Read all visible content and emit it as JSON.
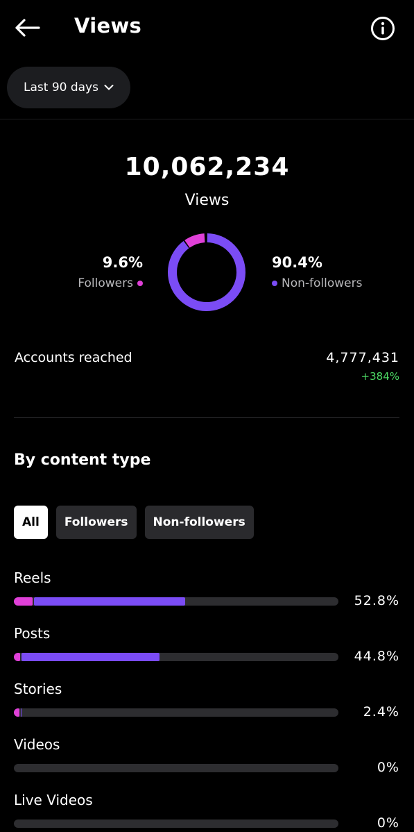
{
  "header": {
    "title": "Views",
    "back_icon": "arrow-left-icon",
    "info_icon": "info-icon"
  },
  "date_range": {
    "label": "Last 90 days",
    "icon": "chevron-down-icon"
  },
  "totals": {
    "value": "10,062,234",
    "label": "Views"
  },
  "audience": {
    "followers": {
      "percent_text": "9.6%",
      "label": "Followers",
      "fraction": 0.096,
      "color": "#e040d8"
    },
    "non_followers": {
      "percent_text": "90.4%",
      "label": "Non-followers",
      "fraction": 0.904,
      "color": "#7b4cf5"
    }
  },
  "reach": {
    "label": "Accounts reached",
    "value": "4,777,431",
    "change": "+384%",
    "change_color": "#4cd964"
  },
  "content_type": {
    "title": "By content type",
    "filters": [
      {
        "label": "All",
        "active": true
      },
      {
        "label": "Followers",
        "active": false
      },
      {
        "label": "Non-followers",
        "active": false
      }
    ],
    "rows": [
      {
        "label": "Reels",
        "percent_text": "52.8%",
        "total": 0.528,
        "followers": 0.058
      },
      {
        "label": "Posts",
        "percent_text": "44.8%",
        "total": 0.448,
        "followers": 0.02
      },
      {
        "label": "Stories",
        "percent_text": "2.4%",
        "total": 0.024,
        "followers": 0.018
      },
      {
        "label": "Videos",
        "percent_text": "0%",
        "total": 0,
        "followers": 0
      },
      {
        "label": "Live Videos",
        "percent_text": "0%",
        "total": 0,
        "followers": 0
      }
    ]
  }
}
